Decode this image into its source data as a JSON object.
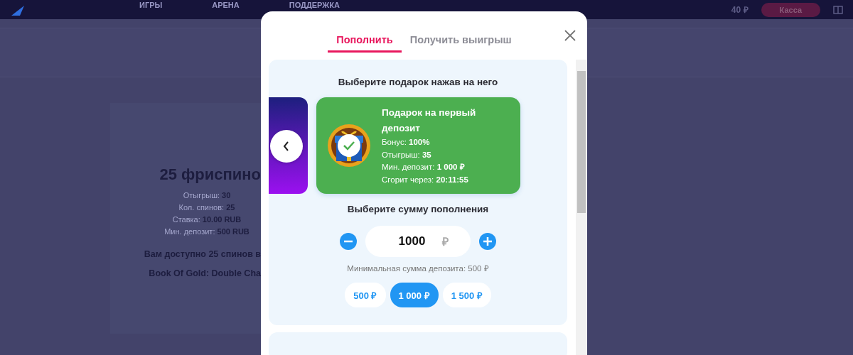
{
  "top_nav": {
    "items": [
      {
        "label": "ИГРЫ"
      },
      {
        "label": "АРЕНА"
      },
      {
        "label": "ПОДДЕРЖКА"
      }
    ],
    "balance": "40 ₽",
    "cashier_button": "Касса"
  },
  "background_card": {
    "title": "25 фриспино",
    "details": [
      "Отыгрыш: **30**",
      "Кол. спинов: **25**",
      "Ставка: **10.00 RUB**",
      "Мин. депозит: **500 RUB**"
    ],
    "description": [
      "Вам доступно 25 спинов в",
      "Book Of Gold: Double Cha"
    ]
  },
  "modal": {
    "tabs": [
      {
        "label": "Пополнить",
        "selected": true
      },
      {
        "label": "Получить выигрыш",
        "selected": false
      }
    ],
    "gift_heading": "Выберите подарок нажав на него",
    "gifts": [
      {
        "kind": "partial",
        "selected": false
      },
      {
        "kind": "bonus",
        "selected": true,
        "title": "Подарок на первый депозит",
        "details": [
          "Бонус: **100%**",
          "Отыгрыш: **35**",
          "Мин. депозит: **1 000 ₽**",
          "Сгорит через: **20:11:55**"
        ]
      }
    ],
    "amount_heading": "Выберите сумму пополнения",
    "amount": {
      "value": "1000",
      "currency": "₽"
    },
    "min_note": "Минимальная сумма депозита: 500 ₽",
    "presets": [
      {
        "label": "500 ₽",
        "selected": false
      },
      {
        "label": "1 000 ₽",
        "selected": true
      },
      {
        "label": "1 500 ₽",
        "selected": false
      }
    ]
  }
}
